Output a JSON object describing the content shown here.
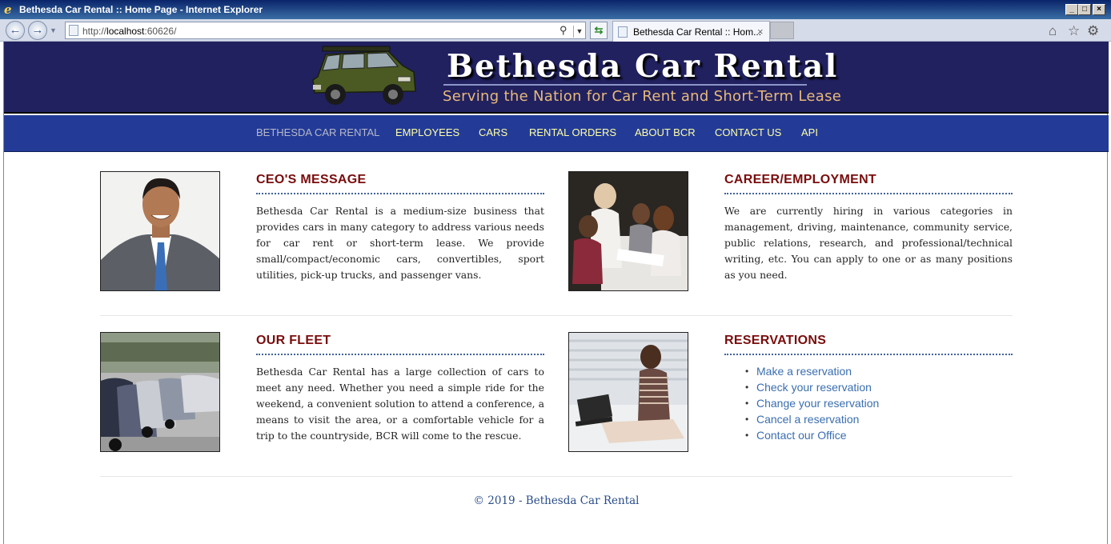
{
  "window": {
    "title": "Bethesda Car Rental :: Home Page - Internet Explorer",
    "url_prefix": "http://",
    "url_host": "localhost",
    "url_rest": ":60626/",
    "tab_label": "Bethesda Car Rental :: Hom...",
    "icons": [
      "ie-logo-icon",
      "back-icon",
      "forward-icon",
      "search-icon",
      "refresh-icon",
      "close-tab-icon",
      "home-icon",
      "star-icon",
      "gear-icon"
    ]
  },
  "site": {
    "brand": "Bethesda Car Rental",
    "tagline": "Serving the Nation for Car Rent and Short-Term Lease",
    "nav": [
      "BETHESDA CAR RENTAL",
      "EMPLOYEES",
      "CARS",
      "RENTAL ORDERS",
      "ABOUT BCR",
      "CONTACT US",
      "API"
    ]
  },
  "sections": {
    "ceo": {
      "heading": "CEO'S MESSAGE",
      "body": "Bethesda Car Rental is a medium-size business that provides cars in many category to address various needs for car rent or short-term lease. We provide small/compact/economic cars, convertibles, sport utilities, pick-up trucks, and passenger vans."
    },
    "career": {
      "heading": "CAREER/EMPLOYMENT",
      "body": "We are currently hiring in various categories in management, driving, maintenance, community service, public relations, research, and professional/technical writing, etc. You can apply to one or as many positions as you need."
    },
    "fleet": {
      "heading": "OUR FLEET",
      "body": "Bethesda Car Rental has a large collection of cars to meet any need. Whether you need a simple ride for the weekend, a convenient solution to attend a conference, a means to visit the area, or a comfortable vehicle for a trip to the countryside, BCR will come to the rescue."
    },
    "reservations": {
      "heading": "RESERVATIONS",
      "links": [
        "Make a reservation",
        "Check your reservation",
        "Change your reservation",
        "Cancel a reservation",
        "Contact our Office"
      ]
    }
  },
  "footer": "© 2019 - Bethesda Car Rental",
  "colors": {
    "header_bg": "#212160",
    "nav_bg": "#233b97",
    "nav_text": "#ffffa6",
    "heading": "#7a0c0c",
    "link": "#3a6eb0"
  }
}
